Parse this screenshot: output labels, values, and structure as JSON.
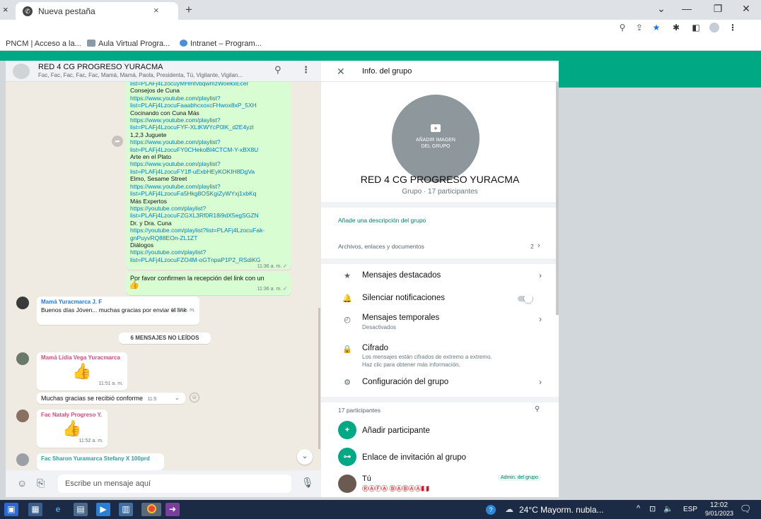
{
  "browser": {
    "tab_prev_close": "×",
    "tab_title": "Nueva pestaña",
    "tab_close": "×",
    "new_tab": "+",
    "win_minimize_chevron": "⌄",
    "win_minimize": "—",
    "win_restore": "❐",
    "win_close": "✕",
    "bookmarks": [
      {
        "label": "PNCM | Acceso a la..."
      },
      {
        "label": "Aula Virtual Progra..."
      },
      {
        "label": "Intranet – Program..."
      }
    ]
  },
  "chat": {
    "name": "RED 4 CG PROGRESO YURACMA",
    "members": "Fac, Fac, Fac, Fac, Fac, Mamá, Mamá, Paola, Presidenta, Tú, Vigilante, Vigilan...",
    "links_message": {
      "lines": [
        {
          "t": "link",
          "v": "list=PLAFj4LzocuyMHmfvbqwmzWoekxEcer"
        },
        {
          "t": "text",
          "v": "Consejos de Cuna"
        },
        {
          "t": "link",
          "v": "https://www.youtube.com/playlist?"
        },
        {
          "t": "link",
          "v": "list=PLAFj4LzocuFaaabhcxoxcFHwox8xP_5XH"
        },
        {
          "t": "text",
          "v": "Cocinando con Cuna Más"
        },
        {
          "t": "link",
          "v": "https://www.youtube.com/playlist?"
        },
        {
          "t": "link",
          "v": "list=PLAFj4LzocuFYF-XLtKWYcP0IK_d2E4yzl"
        },
        {
          "t": "text",
          "v": "1,2,3 Juguete"
        },
        {
          "t": "link",
          "v": "https://www.youtube.com/playlist?"
        },
        {
          "t": "link",
          "v": "list=PLAFj4LzocuFY0CHekoBl4CTCM-Y-xBX8U"
        },
        {
          "t": "text",
          "v": "Arte en el Plato"
        },
        {
          "t": "link",
          "v": "https://www.youtube.com/playlist?"
        },
        {
          "t": "link",
          "v": "list=PLAFj4LzocuFY1ff-uExbHEyKOKIH8DgVa"
        },
        {
          "t": "text",
          "v": "Elmo, Sesame Street"
        },
        {
          "t": "link",
          "v": "https://www.youtube.com/playlist?"
        },
        {
          "t": "link",
          "v": "list=PLAFj4LzocuFa5Hkg8OSKgiZyWYxj1xbKq"
        },
        {
          "t": "text",
          "v": "Más Expertos"
        },
        {
          "t": "link",
          "v": "https://youtube.com/playlist?"
        },
        {
          "t": "link",
          "v": "list=PLAFj4LzocuFZGXL3Rf0R18i9dX5egSGZN"
        },
        {
          "t": "text",
          "v": "Dr. y Dra. Cuna"
        },
        {
          "t": "link",
          "v": "https://youtube.com/playlist?list=PLAFj4LzocuFak-"
        },
        {
          "t": "link",
          "v": "gnPuyvRQ88EOn-ZL1ZT"
        },
        {
          "t": "text",
          "v": "Diálogos"
        },
        {
          "t": "link",
          "v": "https://youtube.com/playlist?"
        },
        {
          "t": "link",
          "v": "list=PLAFj4LzocuFZO4M-oGTnpaP1P2_RSdiKG"
        }
      ],
      "time": "11:36 a. m. ✓"
    },
    "confirm_message": {
      "text": "Por favor confirmen la recepción del link con un",
      "emoji": "👍",
      "time": "11:36 a. m. ✓"
    },
    "mama_message": {
      "sender": "Mamá Yuracmarca J. F",
      "text": "Buenos días Jóven... muchas gracias por enviar el link",
      "time": "11:47 a. m."
    },
    "unread_label": "6 MENSAJES NO LEÍDOS",
    "lidia_sticker": {
      "sender": "Mamá Lidia Vega Yuracmarca",
      "emoji": "👍",
      "time": "11:51 a. m."
    },
    "lidia_text": {
      "text": "Muchas gracias se recibió conforme",
      "time": "11:5"
    },
    "nataly_sticker": {
      "sender": "Fac Nataly Progreso Y.",
      "emoji": "👍",
      "time": "11:52 a. m."
    },
    "sharon_sender": "Fac Sharon Yuramarca Stefany X 100prd",
    "composer_placeholder": "Escribe un mensaje aquí"
  },
  "group_info": {
    "header_title": "Info. del grupo",
    "add_image": "AÑADIR IMAGEN\nDEL GRUPO",
    "group_name": "RED 4 CG PROGRESO YURACMA",
    "group_sub": "Grupo · 17 participantes",
    "add_description": "Añade una descripción del grupo",
    "files_label": "Archivos, enlaces y documentos",
    "files_count": "2",
    "starred": "Mensajes destacados",
    "mute": "Silenciar notificaciones",
    "temp_messages": "Mensajes temporales",
    "temp_sub": "Desactivados",
    "encryption": "Cifrado",
    "encryption_sub": "Los mensajes están cifrados de extremo a extremo.\nHaz clic para obtener más información.",
    "group_settings": "Configuración del grupo",
    "participants_label": "17 participantes",
    "add_participant": "Añadir participante",
    "invite_link": "Enlace de invitación al grupo",
    "me_name": "Tú",
    "me_status": "ⓇⒶⒻⒶ ⒷⒶⒷⒶⒶ🇵🇪",
    "admin_badge": "Admin. del grupo"
  },
  "taskbar": {
    "weather": "24°C  Mayorm. nubla...",
    "lang": "ESP",
    "time": "12:02",
    "date": "9/01/2023"
  },
  "colors": {
    "wa_green": "#00a884",
    "link": "#027eb5",
    "bubble_out": "#d9fdd3"
  }
}
